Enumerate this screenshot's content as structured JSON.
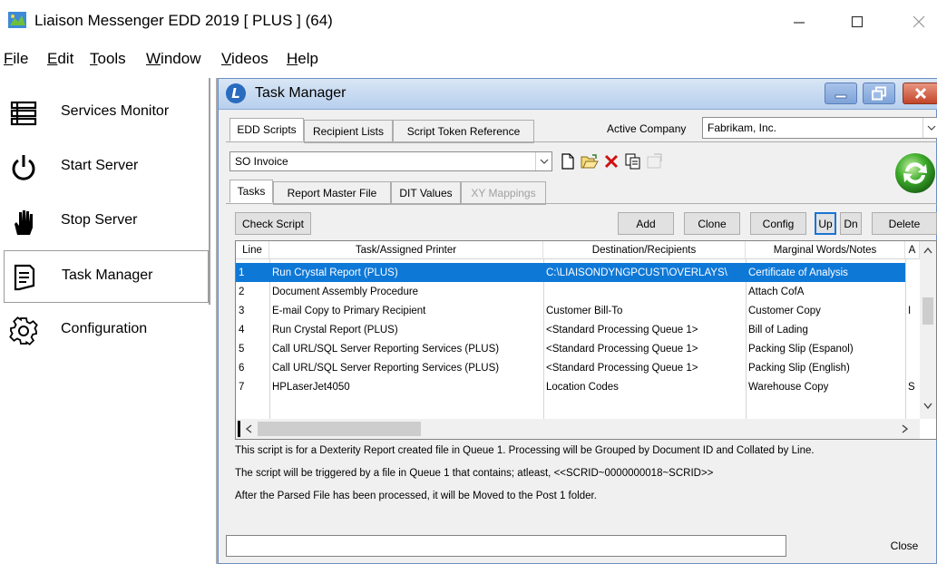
{
  "window": {
    "title": "Liaison Messenger EDD 2019 [ PLUS ] (64)",
    "icon": "liaison-app-icon"
  },
  "menu": {
    "items": [
      {
        "label": "File"
      },
      {
        "label": "Edit"
      },
      {
        "label": "Tools"
      },
      {
        "label": "Window"
      },
      {
        "label": "Videos"
      },
      {
        "label": "Help"
      }
    ]
  },
  "nav": {
    "items": [
      {
        "label": "Services Monitor",
        "icon": "list-icon"
      },
      {
        "label": "Start Server",
        "icon": "power-icon"
      },
      {
        "label": "Stop Server",
        "icon": "hand-stop-icon"
      },
      {
        "label": "Task Manager",
        "icon": "document-icon",
        "active": true
      },
      {
        "label": "Configuration",
        "icon": "gear-icon"
      }
    ]
  },
  "task_manager": {
    "title": "Task Manager",
    "top_tabs": [
      "EDD Scripts",
      "Recipient Lists",
      "Script Token Reference"
    ],
    "active_company_label": "Active Company",
    "active_company_value": "Fabrikam, Inc.",
    "script_value": "SO Invoice",
    "sub_tabs": [
      "Tasks",
      "Report Master File",
      "DIT Values",
      "XY Mappings"
    ],
    "buttons": {
      "check_script": "Check Script",
      "add": "Add",
      "clone": "Clone",
      "config": "Config",
      "up": "Up",
      "dn": "Dn",
      "delete": "Delete",
      "close": "Close"
    },
    "grid": {
      "columns": [
        "Line",
        "Task/Assigned Printer",
        "Destination/Recipients",
        "Marginal Words/Notes",
        "A"
      ],
      "rows": [
        {
          "line": "1",
          "task": "Run Crystal Report (PLUS)",
          "dest": "C:\\LIAISONDYNGPCUST\\OVERLAYS\\",
          "notes": "Certificate of Analysis",
          "extra": ""
        },
        {
          "line": "2",
          "task": "Document Assembly Procedure",
          "dest": "",
          "notes": "Attach CofA",
          "extra": ""
        },
        {
          "line": "3",
          "task": "E-mail Copy to Primary Recipient",
          "dest": "Customer Bill-To",
          "notes": "Customer Copy",
          "extra": "I"
        },
        {
          "line": "4",
          "task": "Run Crystal Report (PLUS)",
          "dest": "<Standard Processing Queue 1>",
          "notes": "Bill of Lading",
          "extra": ""
        },
        {
          "line": "5",
          "task": "Call URL/SQL Server Reporting Services (PLUS)",
          "dest": "<Standard Processing Queue 1>",
          "notes": "Packing Slip (Espanol)",
          "extra": ""
        },
        {
          "line": "6",
          "task": "Call URL/SQL Server Reporting Services (PLUS)",
          "dest": "<Standard Processing Queue 1>",
          "notes": "Packing Slip (English)",
          "extra": ""
        },
        {
          "line": "7",
          "task": "HPLaserJet4050",
          "dest": "Location Codes",
          "notes": "Warehouse Copy",
          "extra": "S"
        }
      ],
      "selected_row": 1
    },
    "info": [
      "This script is for a Dexterity Report created file in Queue 1. Processing will be Grouped by Document ID and Collated by Line.",
      "The script will be triggered by a file in Queue 1 that contains; atleast, <<SCRID~0000000018~SCRID>>",
      "After the Parsed File has been processed, it will be Moved to the Post 1 folder."
    ],
    "status_text": ""
  }
}
